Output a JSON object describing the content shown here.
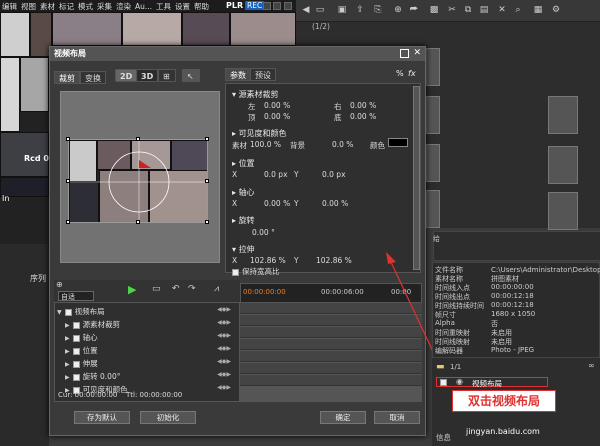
{
  "menubar": {
    "items": [
      "编辑",
      "视图",
      "素材",
      "标记",
      "模式",
      "采集",
      "渲染",
      "Au...",
      "工具",
      "设置",
      "帮助"
    ],
    "plr": "PLR",
    "rec": "REC"
  },
  "right_top": {
    "count": "(1/2)"
  },
  "dialog": {
    "title": "视频布局",
    "left_tabs": [
      "裁剪",
      "变换"
    ],
    "toolbar": [
      "2D",
      "3D"
    ],
    "right_tabs": [
      "参数",
      "预设"
    ],
    "percent": "%",
    "fx": "fx",
    "sections": {
      "crop": {
        "header": "源素材裁剪",
        "left_label": "左",
        "left_value": "0.00 %",
        "right_label": "右",
        "right_value": "0.00 %",
        "top_label": "顶",
        "top_value": "0.00 %",
        "bottom_label": "底",
        "bottom_value": "0.00 %"
      },
      "visibility": {
        "header": "可见度和颜色",
        "source_label": "素材",
        "source_value": "100.0 %",
        "bg_label": "背景",
        "bg_value": "0.0 %",
        "color_label": "颜色"
      },
      "position": {
        "header": "位置",
        "x_label": "X",
        "x_value": "0.0 px",
        "y_label": "Y",
        "y_value": "0.0 px"
      },
      "pivot": {
        "header": "轴心",
        "x_label": "X",
        "x_value": "0.00 %",
        "y_label": "Y",
        "y_value": "0.00 %"
      },
      "rotate": {
        "header": "旋转",
        "value": "0.00 °"
      },
      "stretch": {
        "header": "拉伸",
        "x_label": "X",
        "x_value": "102.86 %",
        "y_label": "Y",
        "y_value": "102.86 %"
      },
      "keep": "保持宽高比"
    },
    "timeline": {
      "dropdown": "自适",
      "timecodes": [
        "00:00:00:00",
        "00:00:06:00",
        "00:00"
      ]
    },
    "tree": [
      {
        "label": "视频布局",
        "level": 0
      },
      {
        "label": "源素材裁剪",
        "level": 1
      },
      {
        "label": "轴心",
        "level": 1
      },
      {
        "label": "位置",
        "level": 1
      },
      {
        "label": "伸展",
        "level": 1
      },
      {
        "label": "旋转",
        "level": 1,
        "value": "0.00°"
      },
      {
        "label": "可见度和颜色",
        "level": 1
      }
    ],
    "cur": "Cur: 00:00:00:00",
    "ttl": "Ttl: 00:00:00:00",
    "buttons": {
      "save_default": "存为默认",
      "init": "初始化",
      "ok": "确定",
      "cancel": "取消"
    }
  },
  "properties": {
    "tab": "给",
    "rows": [
      {
        "k": "文件名称",
        "v": "C:\\Users\\Administrator\\Desktop\\新"
      },
      {
        "k": "素材名称",
        "v": "拼图素材"
      },
      {
        "k": "时间线入点",
        "v": "00:00:00:00"
      },
      {
        "k": "时间线出点",
        "v": "00:00:12:18"
      },
      {
        "k": "时间线持续时间",
        "v": "00:00:12:18"
      },
      {
        "k": "帧尺寸",
        "v": "1680 x 1050"
      },
      {
        "k": "Alpha",
        "v": "否"
      },
      {
        "k": "时间重映射",
        "v": "未启用"
      },
      {
        "k": "时间线映射",
        "v": "未启用"
      },
      {
        "k": "编解码器",
        "v": "Photo - JPEG"
      }
    ]
  },
  "layers": {
    "count": "1/1",
    "item": "视频布局",
    "annotation": "双击视频布局",
    "info": "信息"
  },
  "bottom_left": {
    "seq": "序列",
    "rcd": "Rcd 0",
    "in": "In"
  },
  "watermark": "jingyan.baidu.com",
  "colors": {
    "highlight": "#e13030",
    "rec": "#1560c0"
  }
}
